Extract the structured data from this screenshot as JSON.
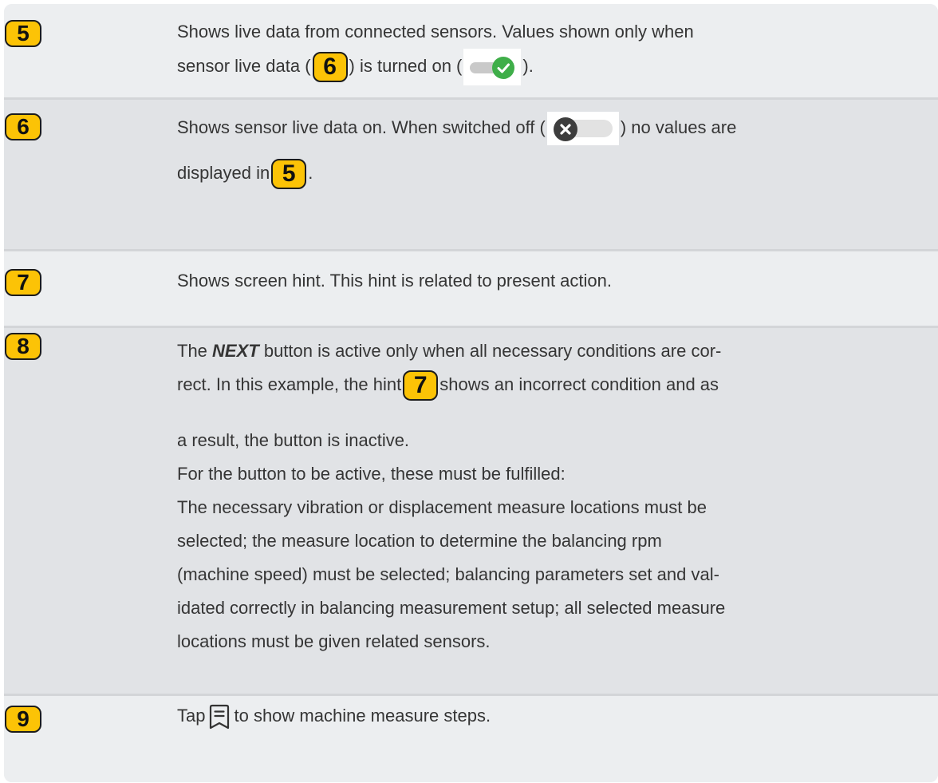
{
  "rows": [
    {
      "badge": "5",
      "text_a": "Shows live data from connected sensors. Values shown only when",
      "text_b": "sensor live data (",
      "inline_badge": "6",
      "text_c": ") is turned on (",
      "text_d": ")."
    },
    {
      "badge": "6",
      "text_a": "Shows sensor live data on. When switched off (",
      "text_b": ") no values are",
      "text_c": "displayed in",
      "inline_badge": "5",
      "text_d": "."
    },
    {
      "badge": "7",
      "text_a": "Shows screen hint. This hint is related to present action."
    },
    {
      "badge": "8",
      "text_a_pre": "The ",
      "text_a_bold": "NEXT",
      "text_a_post": " button is active only when all necessary conditions are cor-",
      "text_b_pre": "rect. In this example, the hint",
      "inline_badge": "7",
      "text_b_post": "shows an incorrect condition and as",
      "text_c": "a result, the button is inactive.",
      "text_d": "For the button to be active, these must be fulfilled:",
      "text_e": "The necessary vibration or displacement measure locations must be",
      "text_f": "selected; the measure location to determine the balancing rpm",
      "text_g": "(machine speed) must be selected; balancing parameters set and val-",
      "text_h": "idated correctly in balancing measurement setup; all selected measure",
      "text_i": "locations must be given related sensors."
    },
    {
      "badge": "9",
      "text_a": "Tap",
      "icon": "steps-list-icon",
      "text_b": "to show machine measure steps."
    }
  ],
  "colors": {
    "badge_fill": "#fcc306",
    "toggle_on_knob": "#3fae49",
    "toggle_off_knob": "#3d3d3d"
  }
}
